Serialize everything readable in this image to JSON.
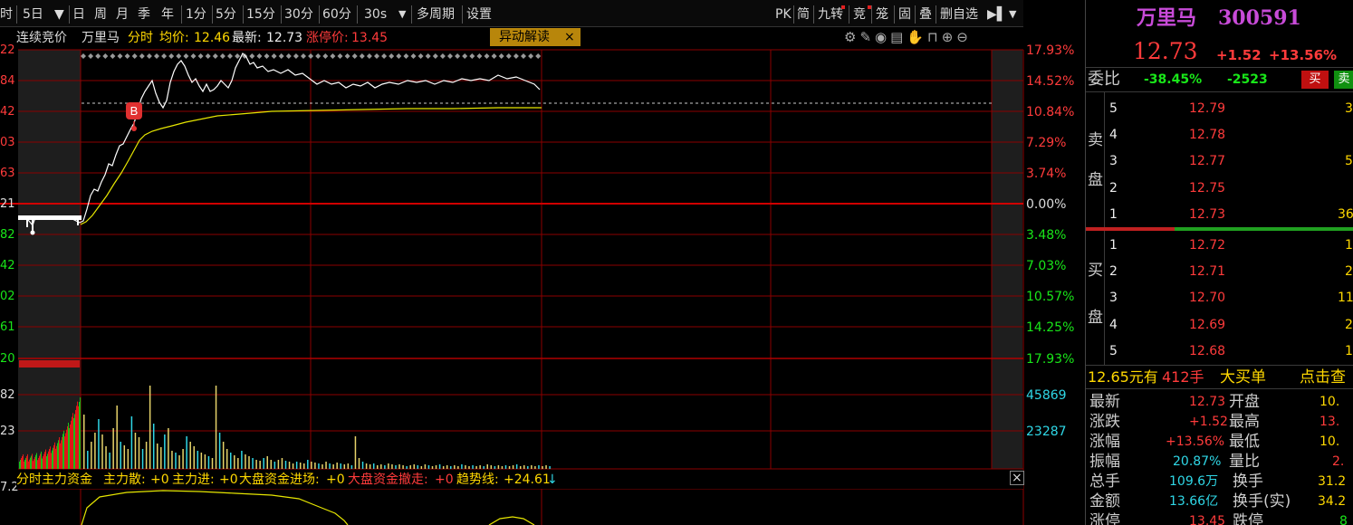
{
  "toolbar": {
    "items": [
      "时",
      "5日",
      "日",
      "周",
      "月",
      "季",
      "年",
      "1分",
      "5分",
      "15分",
      "30分",
      "60分",
      "30s",
      "多周期",
      "设置"
    ],
    "right_items": [
      "PK",
      "简",
      "九转",
      "竞",
      "笼",
      "固",
      "叠",
      "删自选"
    ]
  },
  "chart_header": {
    "mode": "连续竞价",
    "name": "万里马",
    "period": "分时",
    "avg_label": "均价:",
    "avg_value": "12.46",
    "latest_label": "最新:",
    "latest_value": "12.73",
    "limit_label": "涨停价:",
    "limit_value": "13.45",
    "anomaly_button": "异动解读",
    "close_x": "×"
  },
  "price_axis_left": [
    "22",
    "84",
    "42",
    "03",
    "63",
    "21",
    "82",
    "42",
    "02",
    "61",
    "20"
  ],
  "price_axis_right": [
    "17.93%",
    "14.52%",
    "10.84%",
    "7.29%",
    "3.74%",
    "0.00%",
    "3.48%",
    "7.03%",
    "10.57%",
    "14.25%",
    "17.93%"
  ],
  "volume_axis_left": [
    "82",
    "23"
  ],
  "volume_axis_right": [
    "45869",
    "23287"
  ],
  "buy_marker": "B",
  "fund_bar": {
    "title": "分时主力资金",
    "items": [
      {
        "label": "主力散:",
        "value": "+0"
      },
      {
        "label": "主力进:",
        "value": "+0"
      },
      {
        "label": "大盘资金进场:",
        "value": "+0"
      },
      {
        "label": "大盘资金撤走:",
        "value": "+0"
      },
      {
        "label": "趋势线:",
        "value": "+24.61"
      }
    ],
    "arrow": "↓",
    "close": "×",
    "left_axis": "7.2"
  },
  "quote": {
    "name": "万里马",
    "code": "300591",
    "price": "12.73",
    "change": "+1.52",
    "change_pct": "+13.56%",
    "weibi_label": "委比",
    "weibi_pct": "-38.45%",
    "weibi_diff": "-2523",
    "buy_btn": "买",
    "sell_btn": "卖",
    "sell_label": [
      "卖",
      "盘"
    ],
    "buy_label": [
      "买",
      "盘"
    ],
    "asks": [
      {
        "level": "5",
        "price": "12.79",
        "vol": "3"
      },
      {
        "level": "4",
        "price": "12.78",
        "vol": ""
      },
      {
        "level": "3",
        "price": "12.77",
        "vol": "5"
      },
      {
        "level": "2",
        "price": "12.75",
        "vol": ""
      },
      {
        "level": "1",
        "price": "12.73",
        "vol": "36"
      }
    ],
    "bids": [
      {
        "level": "1",
        "price": "12.72",
        "vol": "1"
      },
      {
        "level": "2",
        "price": "12.71",
        "vol": "2"
      },
      {
        "level": "3",
        "price": "12.70",
        "vol": "11"
      },
      {
        "level": "4",
        "price": "12.69",
        "vol": "2"
      },
      {
        "level": "5",
        "price": "12.68",
        "vol": "1"
      }
    ],
    "big_order": {
      "price_text": "12.65元有",
      "qty": "412手",
      "label": "大买单",
      "link": "点击查"
    },
    "stats_left": [
      {
        "label": "最新",
        "value": "12.73"
      },
      {
        "label": "涨跌",
        "value": "+1.52"
      },
      {
        "label": "涨幅",
        "value": "+13.56%"
      },
      {
        "label": "振幅",
        "value": "20.87%"
      },
      {
        "label": "总手",
        "value": "109.6万"
      },
      {
        "label": "金额",
        "value": "13.66亿"
      },
      {
        "label": "涨停",
        "value": "13.45"
      }
    ],
    "stats_right": [
      {
        "label": "开盘",
        "value": "10."
      },
      {
        "label": "最高",
        "value": "13."
      },
      {
        "label": "最低",
        "value": "10."
      },
      {
        "label": "量比",
        "value": "2."
      },
      {
        "label": "换手",
        "value": "31.2"
      },
      {
        "label": "换手(实)",
        "value": "34.2"
      },
      {
        "label": "跌停",
        "value": "8"
      }
    ]
  },
  "colors": {
    "up": "#ff3b3b",
    "down": "#19e619",
    "grid": "#8b0000",
    "avg": "#e6e600",
    "price": "#ffffff"
  }
}
